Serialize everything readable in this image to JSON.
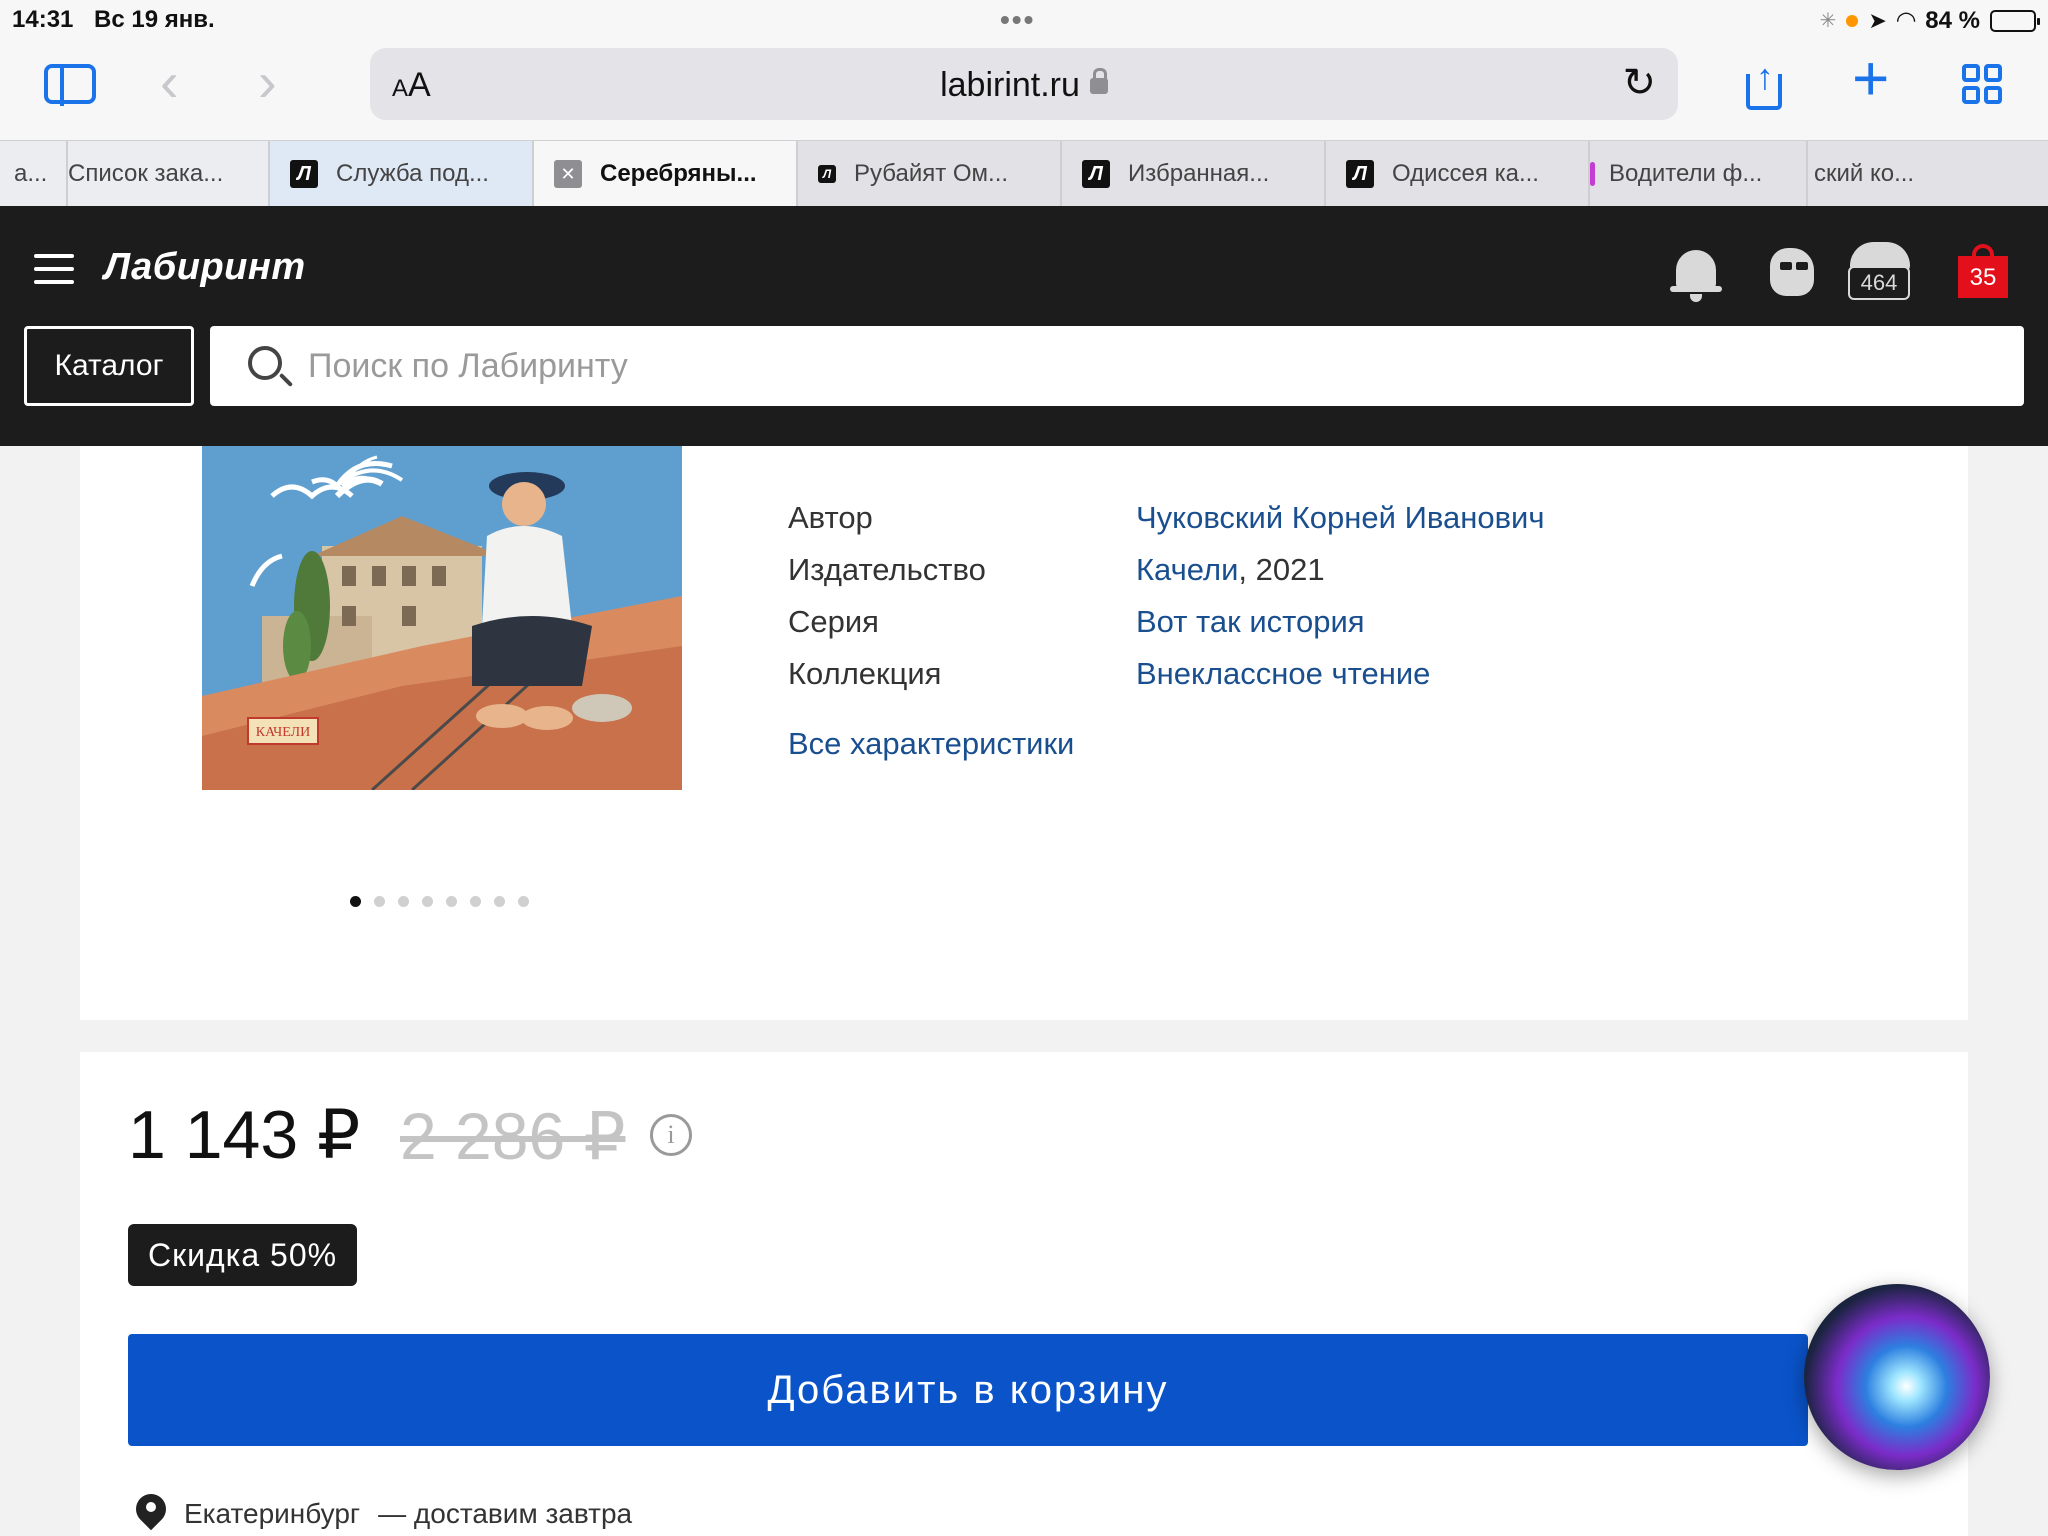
{
  "statusbar": {
    "time": "14:31",
    "date": "Вс 19 янв.",
    "battery": "84 %"
  },
  "browser": {
    "aa_label": "AA",
    "url_host": "labirint.ru",
    "tabs": [
      {
        "title": "а..."
      },
      {
        "title": "Список зака..."
      },
      {
        "title": "Служба под..."
      },
      {
        "title": "Серебряны..."
      },
      {
        "title": "Рубайят Ом..."
      },
      {
        "title": "Избранная..."
      },
      {
        "title": "Одиссея ка..."
      },
      {
        "title": "Водители ф..."
      },
      {
        "title": "ский ко..."
      }
    ],
    "active_tab_index": 3
  },
  "site": {
    "logo": "Лабиринт",
    "favorites_count": "464",
    "cart_count": "35",
    "catalog_label": "Каталог",
    "search_placeholder": "Поиск по Лабиринту"
  },
  "product": {
    "cover_label": "КАЧЕЛИ",
    "specs": [
      {
        "label": "Автор",
        "value": "Чуковский Корней Иванович"
      },
      {
        "label": "Издательство",
        "value": "Качели",
        "suffix": ", 2021"
      },
      {
        "label": "Серия",
        "value": "Вот так история"
      },
      {
        "label": "Коллекция",
        "value": "Внеклассное чтение"
      }
    ],
    "all_specs_link": "Все характеристики",
    "gallery_dots": 8,
    "gallery_active": 0
  },
  "purchase": {
    "price": "1 143 ₽",
    "old_price": "2 286 ₽",
    "discount_label": "Скидка 50%",
    "add_to_cart_label": "Добавить в корзину",
    "city": "Екатеринбург",
    "delivery_text": "— доставим завтра"
  },
  "colors": {
    "header_bg": "#1c1c1c",
    "link": "#1a4f8f",
    "cart_button": "#0a53c9",
    "cart_badge": "#e3101c",
    "safari_accent": "#1a73e8"
  }
}
